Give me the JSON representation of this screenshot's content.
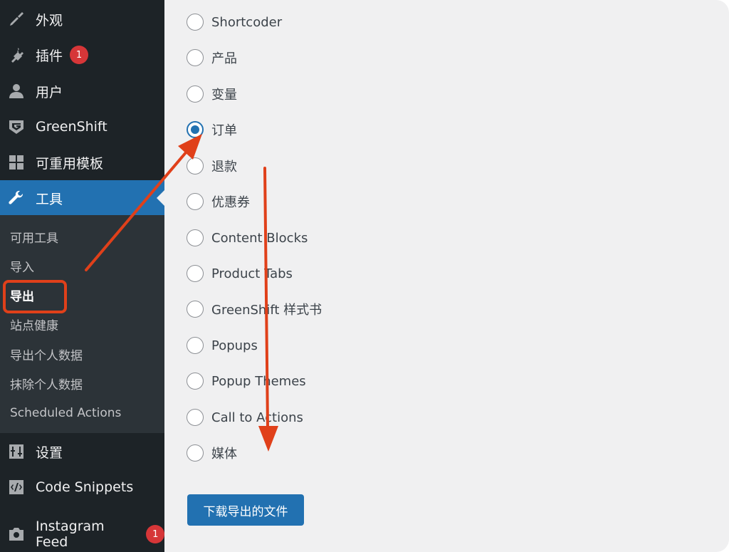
{
  "sidebar": {
    "menu": [
      {
        "label": "外观",
        "icon": "paintbrush-icon"
      },
      {
        "label": "插件",
        "icon": "plugin-icon",
        "badge": "1"
      },
      {
        "label": "用户",
        "icon": "user-icon"
      },
      {
        "label": "GreenShift",
        "icon": "greenshift-logo-icon"
      },
      {
        "label": "可重用模板",
        "icon": "grid-icon"
      },
      {
        "label": "工具",
        "icon": "wrench-icon",
        "active": true
      }
    ],
    "submenu": [
      {
        "label": "可用工具"
      },
      {
        "label": "导入"
      },
      {
        "label": "导出",
        "current": true
      },
      {
        "label": "站点健康"
      },
      {
        "label": "导出个人数据"
      },
      {
        "label": "抹除个人数据"
      },
      {
        "label": "Scheduled Actions"
      }
    ],
    "menu_bottom": [
      {
        "label": "设置",
        "icon": "settings-icon"
      },
      {
        "label": "Code Snippets",
        "icon": "code-icon"
      },
      {
        "label": "Instagram Feed",
        "icon": "camera-icon",
        "badge": "1"
      }
    ]
  },
  "export": {
    "options": [
      {
        "label": "Shortcoder",
        "checked": false
      },
      {
        "label": "产品",
        "checked": false
      },
      {
        "label": "变量",
        "checked": false
      },
      {
        "label": "订单",
        "checked": true
      },
      {
        "label": "退款",
        "checked": false
      },
      {
        "label": "优惠券",
        "checked": false
      },
      {
        "label": "Content Blocks",
        "checked": false
      },
      {
        "label": "Product Tabs",
        "checked": false
      },
      {
        "label": "GreenShift 样式书",
        "checked": false
      },
      {
        "label": "Popups",
        "checked": false
      },
      {
        "label": "Popup Themes",
        "checked": false
      },
      {
        "label": "Call to Actions",
        "checked": false
      },
      {
        "label": "媒体",
        "checked": false
      }
    ],
    "download_label": "下载导出的文件"
  },
  "colors": {
    "sidebar_bg": "#1d2327",
    "submenu_bg": "#2c3338",
    "accent": "#2271b1",
    "badge": "#d63638",
    "annotation": "#e0401a"
  }
}
